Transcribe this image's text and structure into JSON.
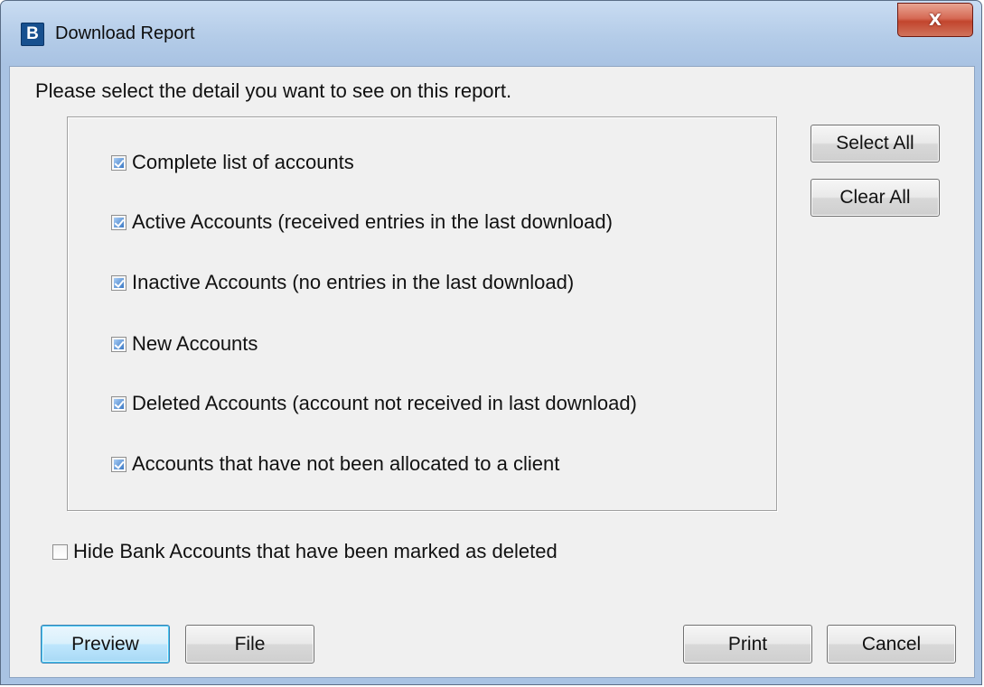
{
  "window": {
    "title": "Download Report",
    "app_icon_letter": "B",
    "close_glyph": "X"
  },
  "prompt": "Please select the detail you want to see on this report.",
  "options": [
    {
      "label": "Complete list of accounts",
      "checked": true
    },
    {
      "label": "Active Accounts (received entries in the last download)",
      "checked": true
    },
    {
      "label": "Inactive Accounts (no entries in the last download)",
      "checked": true
    },
    {
      "label": "New Accounts",
      "checked": true
    },
    {
      "label": "Deleted Accounts (account not received in last download)",
      "checked": true
    },
    {
      "label": "Accounts that have not been allocated to a client",
      "checked": true
    }
  ],
  "side_buttons": {
    "select_all": "Select All",
    "clear_all": "Clear All"
  },
  "hide_deleted": {
    "label": "Hide Bank Accounts that have been marked as deleted",
    "checked": false
  },
  "footer_buttons": {
    "preview": "Preview",
    "file": "File",
    "print": "Print",
    "cancel": "Cancel"
  }
}
